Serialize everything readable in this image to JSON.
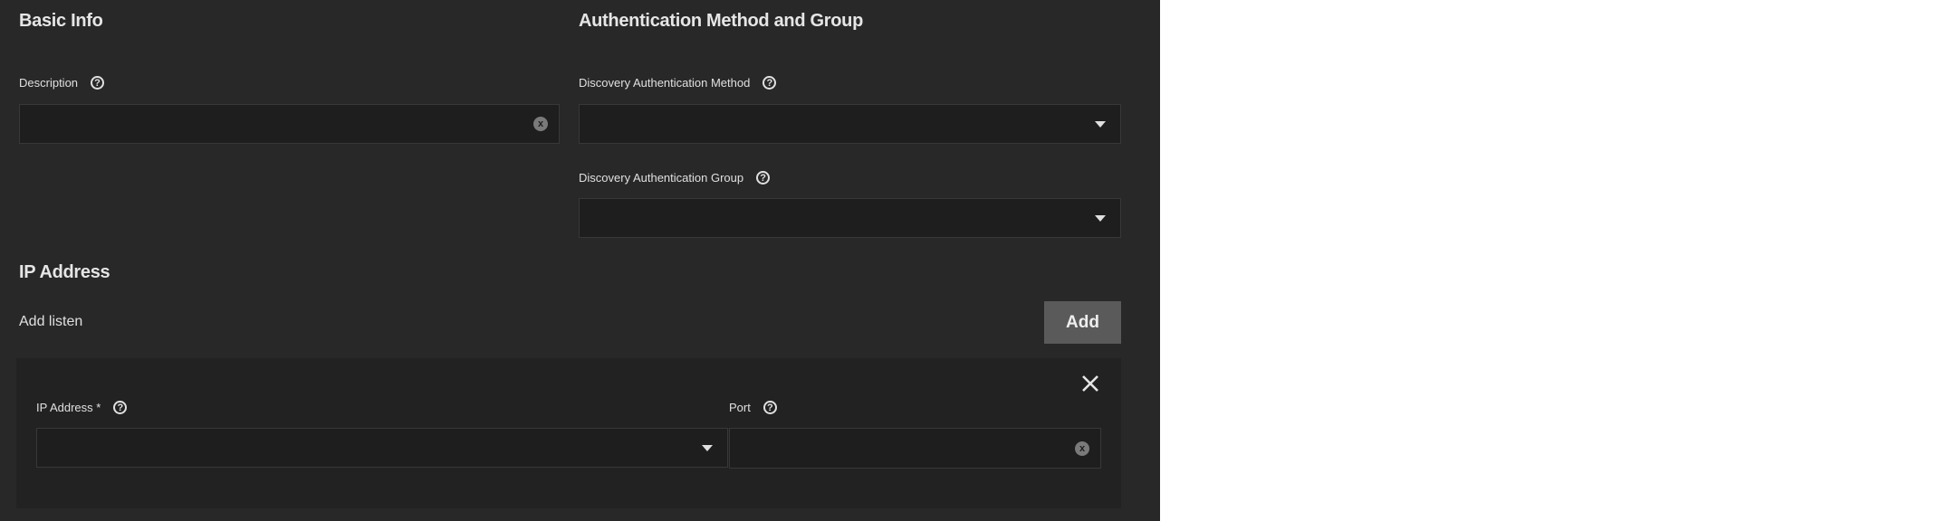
{
  "basic_info": {
    "title": "Basic Info",
    "description_label": "Description",
    "description_value": ""
  },
  "auth": {
    "title": "Authentication Method and Group",
    "method_label": "Discovery Authentication Method",
    "method_value": "",
    "group_label": "Discovery Authentication Group",
    "group_value": ""
  },
  "ip": {
    "title": "IP Address",
    "add_listen_label": "Add listen",
    "add_button": "Add",
    "ip_label": "IP Address *",
    "ip_value": "",
    "port_label": "Port",
    "port_value": ""
  },
  "icons": {
    "help": "?",
    "clear": "x"
  }
}
